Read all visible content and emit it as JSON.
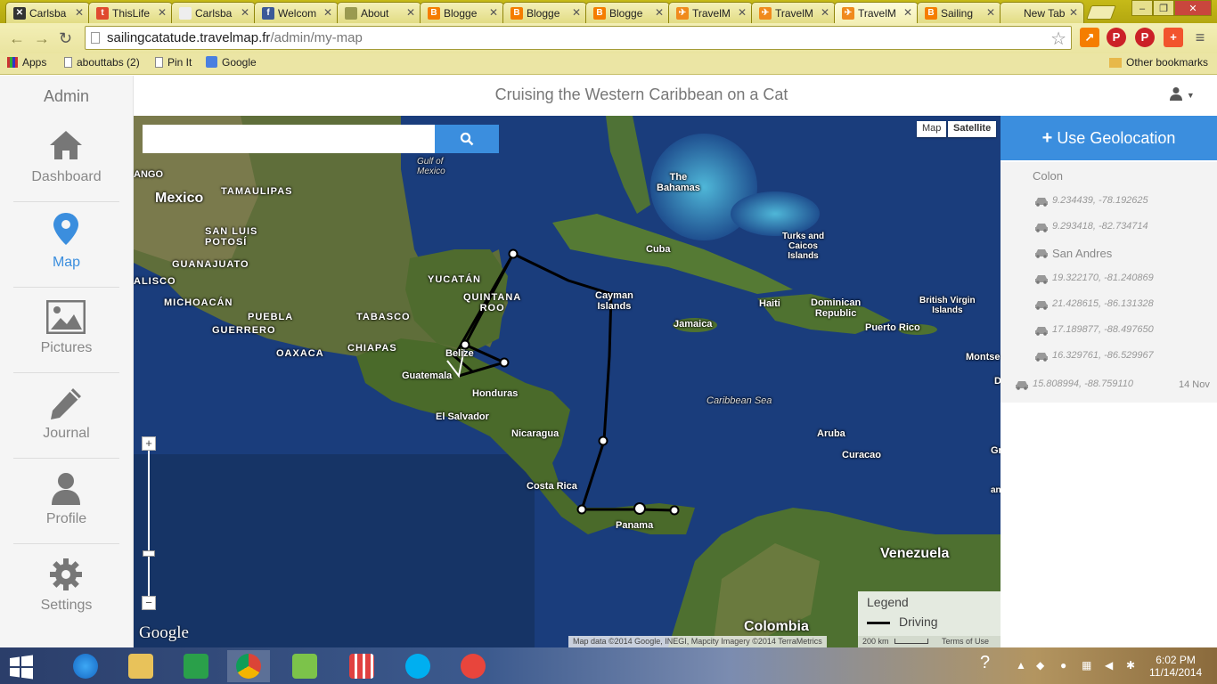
{
  "browser": {
    "tabs": [
      {
        "title": "Carlsba",
        "fav_color": "#333",
        "fav_glyph": "✕"
      },
      {
        "title": "ThisLife",
        "fav_color": "#e04a2f",
        "fav_glyph": "t"
      },
      {
        "title": "Carlsba",
        "fav_color": "#eee",
        "fav_glyph": ""
      },
      {
        "title": "Welcom",
        "fav_color": "#3b5998",
        "fav_glyph": "f"
      },
      {
        "title": "About",
        "fav_color": "#9a9a50",
        "fav_glyph": ""
      },
      {
        "title": "Blogge",
        "fav_color": "#f57d00",
        "fav_glyph": "B"
      },
      {
        "title": "Blogge",
        "fav_color": "#f57d00",
        "fav_glyph": "B"
      },
      {
        "title": "Blogge",
        "fav_color": "#f57d00",
        "fav_glyph": "B"
      },
      {
        "title": "TravelM",
        "fav_color": "#f08a1c",
        "fav_glyph": "✈"
      },
      {
        "title": "TravelM",
        "fav_color": "#f08a1c",
        "fav_glyph": "✈"
      },
      {
        "title": "TravelM",
        "fav_color": "#f08a1c",
        "fav_glyph": "✈",
        "active": true
      },
      {
        "title": "Sailing",
        "fav_color": "#f57d00",
        "fav_glyph": "B"
      },
      {
        "title": "New Tab",
        "fav_color": "",
        "fav_glyph": ""
      }
    ],
    "url_host": "sailingcatatude.travelmap.fr",
    "url_path": "/admin/my-map",
    "bookmarks": {
      "apps": "Apps",
      "abouttabs": "abouttabs (2)",
      "pinit": "Pin It",
      "google": "Google",
      "other": "Other bookmarks"
    }
  },
  "sidebar": {
    "title": "Admin",
    "items": [
      {
        "label": "Dashboard",
        "icon": "home-icon"
      },
      {
        "label": "Map",
        "icon": "map-marker-icon",
        "active": true
      },
      {
        "label": "Pictures",
        "icon": "picture-icon"
      },
      {
        "label": "Journal",
        "icon": "pencil-icon"
      },
      {
        "label": "Profile",
        "icon": "user-icon"
      },
      {
        "label": "Settings",
        "icon": "gear-icon"
      }
    ]
  },
  "header": {
    "title": "Cruising the Western Caribbean on a Cat"
  },
  "map": {
    "search_placeholder": "",
    "type_map": "Map",
    "type_satellite": "Satellite",
    "zoom_in": "+",
    "zoom_out": "−",
    "legend_title": "Legend",
    "legend_item": "Driving",
    "attribution": "Map data ©2014 Google, INEGI, Mapcity Imagery ©2014 TerraMetrics",
    "scale": "200 km",
    "terms": "Terms of Use",
    "google_logo": "Google",
    "labels": {
      "mexico": "Mexico",
      "ango": "ANGO",
      "tamaulipas": "TAMAULIPAS",
      "gulf": "Gulf of\nMexico",
      "san_luis": "SAN LUIS\nPOTOSÍ",
      "guanajuato": "GUANAJUATO",
      "jalisco": "ALISCO",
      "michoacan": "MICHOACÁN",
      "puebla": "PUEBLA",
      "guerrero": "GUERRERO",
      "oaxaca": "OAXACA",
      "tabasco": "TABASCO",
      "chiapas": "CHIAPAS",
      "yucatan": "YUCATÁN",
      "quintana": "QUINTANA\nROO",
      "belize": "Belize",
      "guatemala": "Guatemala",
      "honduras": "Honduras",
      "el_salvador": "El Salvador",
      "nicaragua": "Nicaragua",
      "costa_rica": "Costa Rica",
      "panama": "Panama",
      "colombia": "Colombia",
      "venezuela": "Venezuela",
      "bahamas": "The\nBahamas",
      "cuba": "Cuba",
      "cayman": "Cayman\nIslands",
      "jamaica": "Jamaica",
      "haiti": "Haiti",
      "dominican": "Dominican\nRepublic",
      "turks": "Turks and\nCaicos\nIslands",
      "bvi": "British Virgin\nIslands",
      "puerto_rico": "Puerto Rico",
      "caribbean": "Caribbean Sea",
      "aruba": "Aruba",
      "curacao": "Curacao",
      "montse": "Montse",
      "gr": "Gr",
      "d": "D",
      "an": "an"
    }
  },
  "right_panel": {
    "geolocation_button": "Use Geolocation",
    "locations": [
      {
        "name": "Colon",
        "type": "named-header"
      },
      {
        "name": "9.234439, -78.192625",
        "type": "coords"
      },
      {
        "name": "9.293418, -82.734714",
        "type": "coords"
      },
      {
        "name": "San Andres",
        "type": "named"
      },
      {
        "name": "19.322170, -81.240869",
        "type": "coords"
      },
      {
        "name": "21.428615, -86.131328",
        "type": "coords"
      },
      {
        "name": "17.189877, -88.497650",
        "type": "coords"
      },
      {
        "name": "16.329761, -86.529967",
        "type": "coords"
      },
      {
        "name": "15.808994, -88.759110",
        "type": "coords",
        "date": "14 Nov"
      }
    ]
  },
  "taskbar": {
    "time": "6:02 PM",
    "date": "11/14/2014"
  },
  "colors": {
    "accent": "#3b8ede",
    "chrome_theme": "#c6ba18"
  }
}
